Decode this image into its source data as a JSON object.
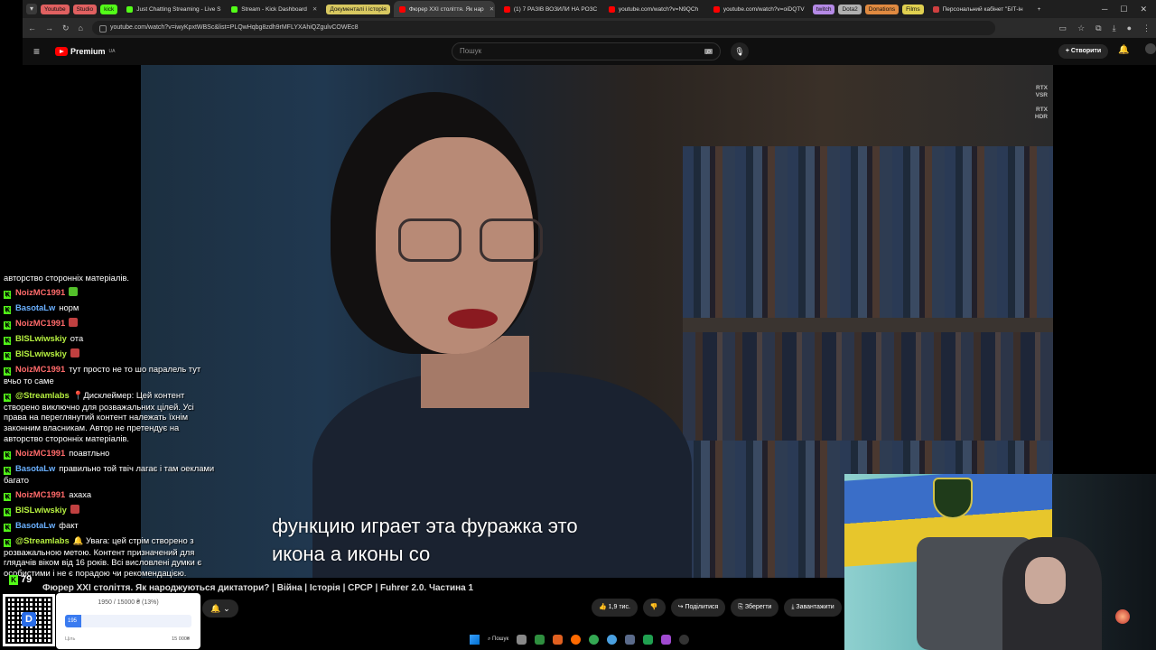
{
  "browser": {
    "chips": [
      {
        "label": "Youtube",
        "color": "#e06060"
      },
      {
        "label": "Studio",
        "color": "#e06060"
      },
      {
        "label": "kick",
        "color": "#53fc18"
      }
    ],
    "tabs": [
      {
        "label": "Just Chatting Streaming - Live S",
        "fav": "#53fc18",
        "active": false
      },
      {
        "label": "Stream - Kick Dashboard",
        "fav": "#53fc18",
        "active": false
      },
      {
        "label": "Документалі і історія",
        "fav": "#f0c020",
        "active": false,
        "chip": true
      },
      {
        "label": "Фюрер XXI століття. Як нар",
        "fav": "#ff0000",
        "active": true
      },
      {
        "label": "(1) 7 РАЗІВ ВОЗИЛИ НА РОЗС",
        "fav": "#ff0000",
        "active": false
      },
      {
        "label": "youtube.com/watch?v=N9QCh",
        "fav": "#ff0000",
        "active": false
      },
      {
        "label": "youtube.com/watch?v=oiDQTV",
        "fav": "#ff0000",
        "active": false
      }
    ],
    "chips2": [
      {
        "label": "twitch",
        "color": "#b58ae6"
      },
      {
        "label": "Dota2",
        "color": "#b0b0b0"
      },
      {
        "label": "Donations",
        "color": "#e08a40"
      },
      {
        "label": "Films",
        "color": "#e0d050"
      }
    ],
    "last_tab": "Персональний кабінет \"БІТ-ін",
    "url": "youtube.com/watch?v=iwyKpxtWBSc&list=PLQwHqbg8zdh9rMFLYXAhiQZgulvCOWEc8"
  },
  "youtube": {
    "logo": "Premium",
    "logo_sup": "UA",
    "search_placeholder": "Пошук",
    "create_label": "Створити",
    "rtx_vsr": [
      "RTX",
      "VSR"
    ],
    "rtx_hdr": [
      "RTX",
      "HDR"
    ],
    "subtitle_lines": [
      "функцию играет эта фуражка это",
      "икона а иконы со"
    ],
    "video_title": "Фюрер XXI століття. Як народжуються диктатори? | Війна | Історія | СРСР | Fuhrer 2.0. Частина 1",
    "likes": "1,9 тис.",
    "share": "Поділитися",
    "save": "Зберегти",
    "download": "Завантажити"
  },
  "chat": {
    "messages": [
      {
        "user": "",
        "text": "авторство сторонніх матеріалів.",
        "color": "#fff",
        "emo": ""
      },
      {
        "user": "NoizMC1991",
        "text": "",
        "color": "#ff6a6a",
        "emo": "#53c02a"
      },
      {
        "user": "BasotaLw",
        "text": "норм",
        "color": "#6ab0ff",
        "emo": ""
      },
      {
        "user": "NoizMC1991",
        "text": "",
        "color": "#ff6a6a",
        "emo": "#c04040"
      },
      {
        "user": "BISLwiwskiy",
        "text": "ота",
        "color": "#b6f040",
        "emo": ""
      },
      {
        "user": "BISLwiwskiy",
        "text": "",
        "color": "#b6f040",
        "emo": "#c04040"
      },
      {
        "user": "NoizMC1991",
        "text": "тут просто не то шо паралель тут вчьо то саме",
        "color": "#ff6a6a",
        "emo": ""
      },
      {
        "user": "@Streamlabs",
        "text": "📍Дисклеймер: Цей контент створено виключно для розважальних цілей. Усі права на переглянутий контент належать їхнім законним власникам. Автор не претендує на авторство сторонніх матеріалів.",
        "color": "#b6f040",
        "emo": ""
      },
      {
        "user": "NoizMC1991",
        "text": "поавтльно",
        "color": "#ff6a6a",
        "emo": ""
      },
      {
        "user": "BasotaLw",
        "text": "правильно той твіч лагає і там оеклами багато",
        "color": "#6ab0ff",
        "emo": ""
      },
      {
        "user": "NoizMC1991",
        "text": "ахаха",
        "color": "#ff6a6a",
        "emo": ""
      },
      {
        "user": "BISLwiwskiy",
        "text": "",
        "color": "#b6f040",
        "emo": "#c04040"
      },
      {
        "user": "BasotaLw",
        "text": "факт",
        "color": "#6ab0ff",
        "emo": ""
      },
      {
        "user": "@Streamlabs",
        "text": "🔔 Увага: цей стрім створено з розважальною метою. Контент призначений для глядачів віком від 16 років. Всі висловлені думки є особистими і не є порадою чи рекомендацією.",
        "color": "#b6f040",
        "emo": ""
      }
    ],
    "viewers": "79"
  },
  "donation": {
    "progress_text": "1950 / 15000 ₴ (13%)",
    "progress_pct": 13,
    "fill_label": "195",
    "goal_left": "Ціль",
    "goal_right": "15 000₴"
  },
  "taskbar": {
    "search_label": "Пошук",
    "apps": [
      "#888",
      "#2f8f3f",
      "#e06020",
      "#ff6a00",
      "#34a853",
      "#4aa0e0",
      "#5a6a8a",
      "#20a050",
      "#a04ad0",
      "#333"
    ]
  }
}
